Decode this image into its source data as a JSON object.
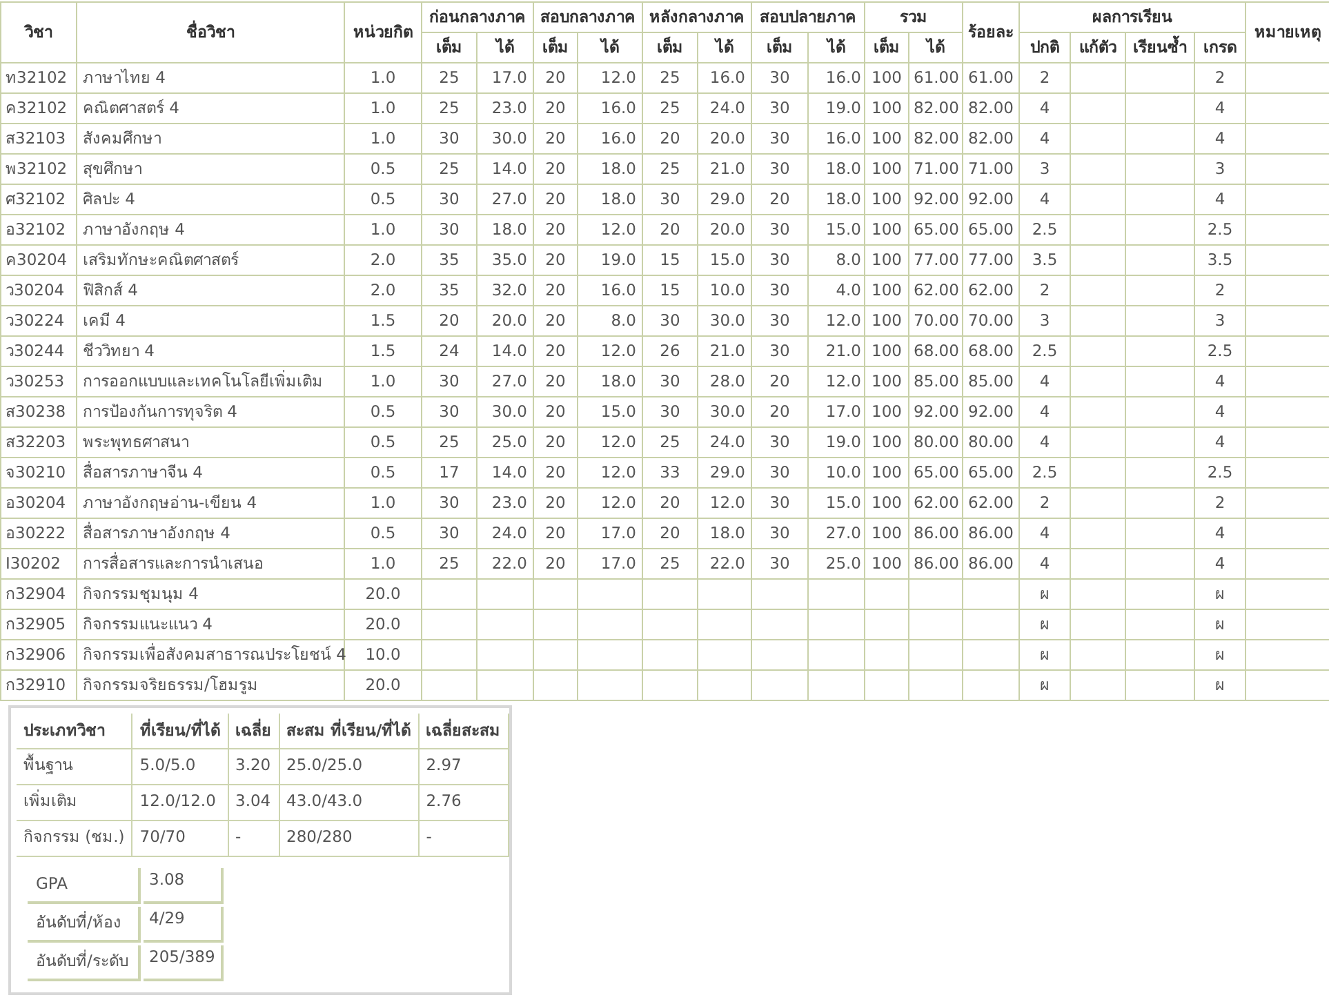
{
  "table": {
    "columns": [
      {
        "label": "วิชา"
      },
      {
        "label": "ชื่อวิชา"
      },
      {
        "label": "หน่วยกิต"
      },
      {
        "label": "ก่อนกลางภาค",
        "sub": [
          "เต็ม",
          "ได้"
        ]
      },
      {
        "label": "สอบกลางภาค",
        "sub": [
          "เต็ม",
          "ได้"
        ]
      },
      {
        "label": "หลังกลางภาค",
        "sub": [
          "เต็ม",
          "ได้"
        ]
      },
      {
        "label": "สอบปลายภาค",
        "sub": [
          "เต็ม",
          "ได้"
        ]
      },
      {
        "label": "รวม",
        "sub": [
          "เต็ม",
          "ได้"
        ]
      },
      {
        "label": "ร้อยละ"
      },
      {
        "label": "ผลการเรียน",
        "sub": [
          "ปกติ",
          "แก้ตัว",
          "เรียนซ้ำ",
          "เกรด"
        ]
      },
      {
        "label": "หมายเหตุ"
      }
    ],
    "rows": [
      {
        "code": "ท32102",
        "name": "ภาษาไทย  4",
        "credits": "1.0",
        "pre_full": "25",
        "pre_got": "17.0",
        "mid_full": "20",
        "mid_got": "12.0",
        "post_full": "25",
        "post_got": "16.0",
        "final_full": "30",
        "final_got": "16.0",
        "total_full": "100",
        "total_got": "61.00",
        "percent": "61.00",
        "normal": "2",
        "grade": "2"
      },
      {
        "code": "ค32102",
        "name": "คณิตศาสตร์ 4",
        "credits": "1.0",
        "pre_full": "25",
        "pre_got": "23.0",
        "mid_full": "20",
        "mid_got": "16.0",
        "post_full": "25",
        "post_got": "24.0",
        "final_full": "30",
        "final_got": "19.0",
        "total_full": "100",
        "total_got": "82.00",
        "percent": "82.00",
        "normal": "4",
        "grade": "4"
      },
      {
        "code": "ส32103",
        "name": "สังคมศึกษา",
        "credits": "1.0",
        "pre_full": "30",
        "pre_got": "30.0",
        "mid_full": "20",
        "mid_got": "16.0",
        "post_full": "20",
        "post_got": "20.0",
        "final_full": "30",
        "final_got": "16.0",
        "total_full": "100",
        "total_got": "82.00",
        "percent": "82.00",
        "normal": "4",
        "grade": "4"
      },
      {
        "code": "พ32102",
        "name": "สุขศึกษา",
        "credits": "0.5",
        "pre_full": "25",
        "pre_got": "14.0",
        "mid_full": "20",
        "mid_got": "18.0",
        "post_full": "25",
        "post_got": "21.0",
        "final_full": "30",
        "final_got": "18.0",
        "total_full": "100",
        "total_got": "71.00",
        "percent": "71.00",
        "normal": "3",
        "grade": "3"
      },
      {
        "code": "ศ32102",
        "name": "ศิลปะ 4",
        "credits": "0.5",
        "pre_full": "30",
        "pre_got": "27.0",
        "mid_full": "20",
        "mid_got": "18.0",
        "post_full": "30",
        "post_got": "29.0",
        "final_full": "20",
        "final_got": "18.0",
        "total_full": "100",
        "total_got": "92.00",
        "percent": "92.00",
        "normal": "4",
        "grade": "4"
      },
      {
        "code": "อ32102",
        "name": "ภาษาอังกฤษ  4",
        "credits": "1.0",
        "pre_full": "30",
        "pre_got": "18.0",
        "mid_full": "20",
        "mid_got": "12.0",
        "post_full": "20",
        "post_got": "20.0",
        "final_full": "30",
        "final_got": "15.0",
        "total_full": "100",
        "total_got": "65.00",
        "percent": "65.00",
        "normal": "2.5",
        "grade": "2.5"
      },
      {
        "code": "ค30204",
        "name": "เสริมทักษะคณิตศาสตร์",
        "credits": "2.0",
        "pre_full": "35",
        "pre_got": "35.0",
        "mid_full": "20",
        "mid_got": "19.0",
        "post_full": "15",
        "post_got": "15.0",
        "final_full": "30",
        "final_got": "8.0",
        "total_full": "100",
        "total_got": "77.00",
        "percent": "77.00",
        "normal": "3.5",
        "grade": "3.5"
      },
      {
        "code": "ว30204",
        "name": "ฟิสิกส์ 4",
        "credits": "2.0",
        "pre_full": "35",
        "pre_got": "32.0",
        "mid_full": "20",
        "mid_got": "16.0",
        "post_full": "15",
        "post_got": "10.0",
        "final_full": "30",
        "final_got": "4.0",
        "total_full": "100",
        "total_got": "62.00",
        "percent": "62.00",
        "normal": "2",
        "grade": "2"
      },
      {
        "code": "ว30224",
        "name": "เคมี 4",
        "credits": "1.5",
        "pre_full": "20",
        "pre_got": "20.0",
        "mid_full": "20",
        "mid_got": "8.0",
        "post_full": "30",
        "post_got": "30.0",
        "final_full": "30",
        "final_got": "12.0",
        "total_full": "100",
        "total_got": "70.00",
        "percent": "70.00",
        "normal": "3",
        "grade": "3"
      },
      {
        "code": "ว30244",
        "name": "ชีววิทยา  4",
        "credits": "1.5",
        "pre_full": "24",
        "pre_got": "14.0",
        "mid_full": "20",
        "mid_got": "12.0",
        "post_full": "26",
        "post_got": "21.0",
        "final_full": "30",
        "final_got": "21.0",
        "total_full": "100",
        "total_got": "68.00",
        "percent": "68.00",
        "normal": "2.5",
        "grade": "2.5"
      },
      {
        "code": "ว30253",
        "name": "การออกแบบและเทคโนโลยีเพิ่มเติม",
        "credits": "1.0",
        "pre_full": "30",
        "pre_got": "27.0",
        "mid_full": "20",
        "mid_got": "18.0",
        "post_full": "30",
        "post_got": "28.0",
        "final_full": "20",
        "final_got": "12.0",
        "total_full": "100",
        "total_got": "85.00",
        "percent": "85.00",
        "normal": "4",
        "grade": "4"
      },
      {
        "code": "ส30238",
        "name": "การป้องกันการทุจริต  4",
        "credits": "0.5",
        "pre_full": "30",
        "pre_got": "30.0",
        "mid_full": "20",
        "mid_got": "15.0",
        "post_full": "30",
        "post_got": "30.0",
        "final_full": "20",
        "final_got": "17.0",
        "total_full": "100",
        "total_got": "92.00",
        "percent": "92.00",
        "normal": "4",
        "grade": "4"
      },
      {
        "code": "ส32203",
        "name": "พระพุทธศาสนา",
        "credits": "0.5",
        "pre_full": "25",
        "pre_got": "25.0",
        "mid_full": "20",
        "mid_got": "12.0",
        "post_full": "25",
        "post_got": "24.0",
        "final_full": "30",
        "final_got": "19.0",
        "total_full": "100",
        "total_got": "80.00",
        "percent": "80.00",
        "normal": "4",
        "grade": "4"
      },
      {
        "code": "จ30210",
        "name": "สื่อสารภาษาจีน  4",
        "credits": "0.5",
        "pre_full": "17",
        "pre_got": "14.0",
        "mid_full": "20",
        "mid_got": "12.0",
        "post_full": "33",
        "post_got": "29.0",
        "final_full": "30",
        "final_got": "10.0",
        "total_full": "100",
        "total_got": "65.00",
        "percent": "65.00",
        "normal": "2.5",
        "grade": "2.5"
      },
      {
        "code": "อ30204",
        "name": "ภาษาอังกฤษอ่าน-เขียน  4",
        "credits": "1.0",
        "pre_full": "30",
        "pre_got": "23.0",
        "mid_full": "20",
        "mid_got": "12.0",
        "post_full": "20",
        "post_got": "12.0",
        "final_full": "30",
        "final_got": "15.0",
        "total_full": "100",
        "total_got": "62.00",
        "percent": "62.00",
        "normal": "2",
        "grade": "2"
      },
      {
        "code": "อ30222",
        "name": "สื่อสารภาษาอังกฤษ  4",
        "credits": "0.5",
        "pre_full": "30",
        "pre_got": "24.0",
        "mid_full": "20",
        "mid_got": "17.0",
        "post_full": "20",
        "post_got": "18.0",
        "final_full": "30",
        "final_got": "27.0",
        "total_full": "100",
        "total_got": "86.00",
        "percent": "86.00",
        "normal": "4",
        "grade": "4"
      },
      {
        "code": "I30202",
        "name": "การสื่อสารและการนำเสนอ",
        "credits": "1.0",
        "pre_full": "25",
        "pre_got": "22.0",
        "mid_full": "20",
        "mid_got": "17.0",
        "post_full": "25",
        "post_got": "22.0",
        "final_full": "30",
        "final_got": "25.0",
        "total_full": "100",
        "total_got": "86.00",
        "percent": "86.00",
        "normal": "4",
        "grade": "4"
      },
      {
        "code": "ก32904",
        "name": "กิจกรรมชุมนุม  4",
        "credits": "20.0",
        "normal": "ผ",
        "grade": "ผ"
      },
      {
        "code": "ก32905",
        "name": "กิจกรรมแนะแนว  4",
        "credits": "20.0",
        "normal": "ผ",
        "grade": "ผ"
      },
      {
        "code": "ก32906",
        "name": "กิจกรรมเพื่อสังคมสาธารณประโยชน์ 4",
        "credits": "10.0",
        "normal": "ผ",
        "grade": "ผ"
      },
      {
        "code": "ก32910",
        "name": "กิจกรรมจริยธรรม/โฮมรูม",
        "credits": "20.0",
        "normal": "ผ",
        "grade": "ผ"
      }
    ]
  },
  "summary": {
    "columns": [
      "ประเภทวิชา",
      "ที่เรียน/ที่ได้",
      "เฉลี่ย",
      "สะสม  ที่เรียน/ที่ได้",
      "เฉลี่ยสะสม"
    ],
    "rows": [
      [
        "พื้นฐาน",
        "5.0/5.0",
        "3.20",
        "25.0/25.0",
        "2.97"
      ],
      [
        "เพิ่มเติม",
        "12.0/12.0",
        "3.04",
        "43.0/43.0",
        "2.76"
      ],
      [
        "กิจกรรม  (ชม.)",
        "70/70",
        "-",
        "280/280",
        "-"
      ]
    ],
    "stats": [
      {
        "label": "GPA",
        "value": "3.08"
      },
      {
        "label": "อันดับที่/ห้อง",
        "value": "4/29"
      },
      {
        "label": "อันดับที่/ระดับ",
        "value": "205/389"
      }
    ]
  }
}
